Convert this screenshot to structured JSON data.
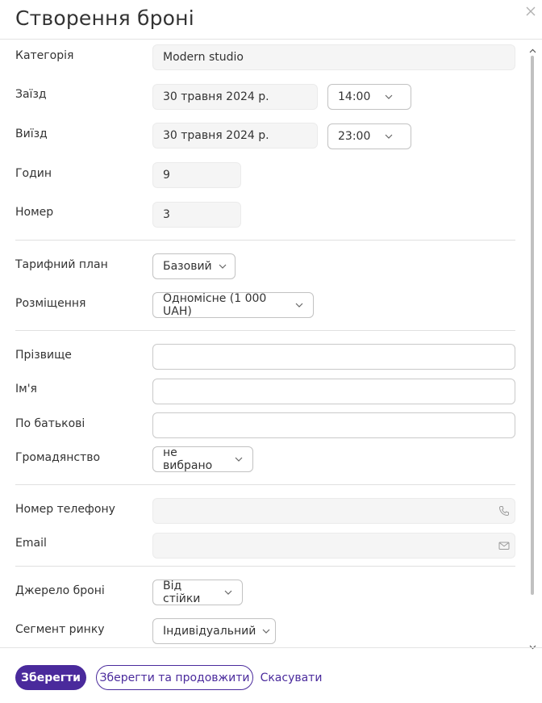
{
  "dialog": {
    "title": "Створення броні"
  },
  "booking": {
    "category_label": "Категорія",
    "category_value": "Modern studio",
    "checkin_label": "Заїзд",
    "checkin_date": "30 травня 2024 р.",
    "checkin_time": "14:00",
    "checkout_label": "Виїзд",
    "checkout_date": "30 травня 2024 р.",
    "checkout_time": "23:00",
    "hours_label": "Годин",
    "hours_value": "9",
    "room_label": "Номер",
    "room_value": "3"
  },
  "rate": {
    "plan_label": "Тарифний план",
    "plan_value": "Базовий",
    "placement_label": "Розміщення",
    "placement_value": "Одномісне (1 000 UAH)"
  },
  "guest": {
    "lastname_label": "Прізвище",
    "lastname_value": "",
    "firstname_label": "Ім'я",
    "firstname_value": "",
    "patronymic_label": "По батькові",
    "patronymic_value": "",
    "citizenship_label": "Громадянство",
    "citizenship_value": "не вибрано"
  },
  "contacts": {
    "phone_label": "Номер телефону",
    "phone_value": "",
    "email_label": "Email",
    "email_value": ""
  },
  "source": {
    "source_label": "Джерело броні",
    "source_value": "Від стійки",
    "segment_label": "Сегмент ринку",
    "segment_value": "Індивідуальний"
  },
  "footer": {
    "save_label": "Зберегти",
    "save_continue_label": "Зберегти та продовжити",
    "cancel_label": "Скасувати"
  },
  "colors": {
    "accent": "#4a2a9c",
    "field_readonly_bg": "#f5f5f5",
    "border": "#c9c9c9"
  },
  "icons": {
    "close": "close-icon",
    "phone": "phone-icon",
    "email": "mail-icon",
    "dropdown": "chevron-down-icon"
  }
}
